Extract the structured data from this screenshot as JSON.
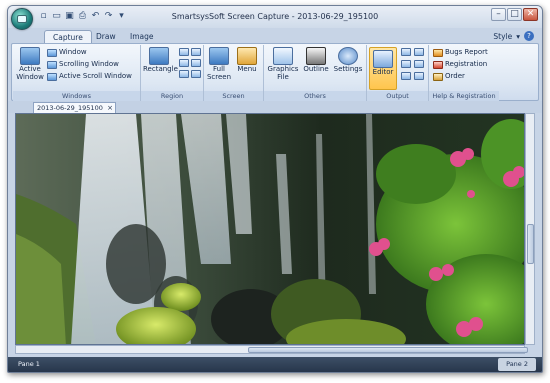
{
  "window": {
    "title": "SmartsysSoft Screen Capture - 2013-06-29_195100",
    "controls": {
      "minimize": "–",
      "maximize": "□",
      "close": "✕"
    }
  },
  "quick_access": [
    "new-icon",
    "open-icon",
    "save-icon",
    "print-icon",
    "undo-icon",
    "redo-icon",
    "customize-icon"
  ],
  "ribbon_tabs": [
    "Capture",
    "Draw",
    "Image"
  ],
  "active_tab": "Capture",
  "style_menu": {
    "label": "Style",
    "help": "?"
  },
  "groups": {
    "windows": {
      "label": "Windows",
      "active_window": "Active\nWindow",
      "window": "Window",
      "scrolling_window": "Scrolling Window",
      "active_scroll_window": "Active Scroll Window"
    },
    "region": {
      "label": "Region",
      "rectangle": "Rectangle"
    },
    "screen": {
      "label": "Screen",
      "full_screen": "Full\nScreen",
      "menu": "Menu"
    },
    "others": {
      "label": "Others",
      "graphics_file": "Graphics\nFile",
      "outline": "Outline",
      "settings": "Settings"
    },
    "output": {
      "label": "Output",
      "editor": "Editor"
    },
    "help": {
      "label": "Help & Registration",
      "bugs_report": "Bugs Report",
      "registration": "Registration",
      "order": "Order"
    }
  },
  "document_tab": {
    "label": "2013-06-29_195100",
    "close": "×"
  },
  "status": {
    "pane1": "Pane 1",
    "pane2": "Pane 2"
  },
  "colors": {
    "accent": "#ffc54d",
    "ribbon": "#dde7f3",
    "statusbar": "#27364b"
  }
}
